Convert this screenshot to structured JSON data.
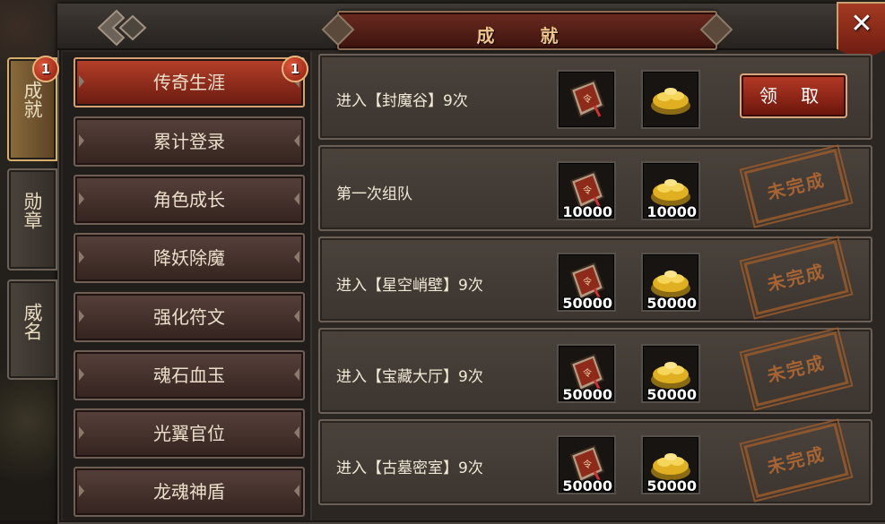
{
  "window": {
    "title": "成 就",
    "close_label": "✕"
  },
  "side_tabs": [
    {
      "label": "成就",
      "badge": "1",
      "active": true
    },
    {
      "label": "勋章"
    },
    {
      "label": "威名"
    }
  ],
  "categories": [
    {
      "label": "传奇生涯",
      "badge": "1",
      "active": true
    },
    {
      "label": "累计登录"
    },
    {
      "label": "角色成长"
    },
    {
      "label": "降妖除魔"
    },
    {
      "label": "强化符文"
    },
    {
      "label": "魂石血玉"
    },
    {
      "label": "光翼官位"
    },
    {
      "label": "龙魂神盾"
    }
  ],
  "achievements": [
    {
      "text": "进入【封魔谷】9次",
      "reward1_icon": "token-icon",
      "reward1_qty": "",
      "reward2_icon": "gold-coins-icon",
      "reward2_qty": "",
      "status": "claim",
      "claim_label": "领 取"
    },
    {
      "text": "第一次组队",
      "reward1_icon": "token-icon",
      "reward1_qty": "10000",
      "reward2_icon": "gold-coins-icon",
      "reward2_qty": "10000",
      "status": "incomplete",
      "stamp_label": "未完成"
    },
    {
      "text": "进入【星空峭壁】9次",
      "reward1_icon": "token-icon",
      "reward1_qty": "50000",
      "reward2_icon": "gold-coins-icon",
      "reward2_qty": "50000",
      "status": "incomplete",
      "stamp_label": "未完成"
    },
    {
      "text": "进入【宝藏大厅】9次",
      "reward1_icon": "token-icon",
      "reward1_qty": "50000",
      "reward2_icon": "gold-coins-icon",
      "reward2_qty": "50000",
      "status": "incomplete",
      "stamp_label": "未完成"
    },
    {
      "text": "进入【古墓密室】9次",
      "reward1_icon": "token-icon",
      "reward1_qty": "50000",
      "reward2_icon": "gold-coins-icon",
      "reward2_qty": "50000",
      "status": "incomplete",
      "stamp_label": "未完成"
    }
  ],
  "colors": {
    "accent_red": "#b63a25",
    "gold_text": "#f0c38a",
    "stamp_brown": "#b86a33"
  }
}
